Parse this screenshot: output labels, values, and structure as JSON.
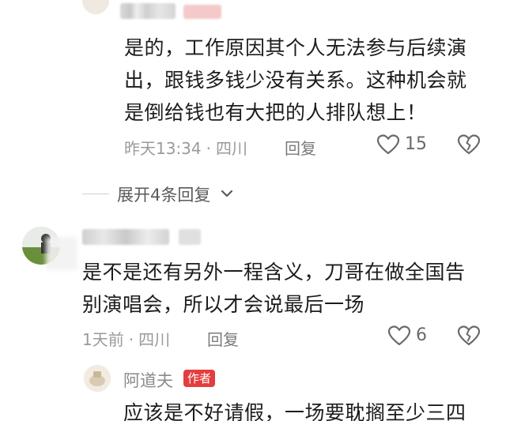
{
  "comment1": {
    "lines": [
      "是的，工作原因其个人无法参与后续演",
      "出，跟钱多钱少没有关系。这种机会就",
      "是倒给钱也有大把的人排队想上！"
    ],
    "time": "昨天13:34",
    "location": "四川",
    "reply_label": "回复",
    "likes": "15"
  },
  "expand": {
    "label": "展开4条回复"
  },
  "comment2": {
    "lines": [
      "是不是还有另外一程含义，刀哥在做全国告",
      "别演唱会，所以才会说最后一场"
    ],
    "time": "1天前",
    "location": "四川",
    "reply_label": "回复",
    "likes": "6"
  },
  "reply": {
    "author": "阿道夫",
    "badge": "作者",
    "text": "应该是不好请假，一场要耽搁至少三四"
  },
  "separator": "·",
  "icons": {
    "like": "heart-outline-icon",
    "dislike": "broken-heart-icon",
    "expand": "chevron-down-icon"
  },
  "colors": {
    "badge": "#e33e3e",
    "meta": "#9a9a9a",
    "text": "#1c1c1c"
  }
}
